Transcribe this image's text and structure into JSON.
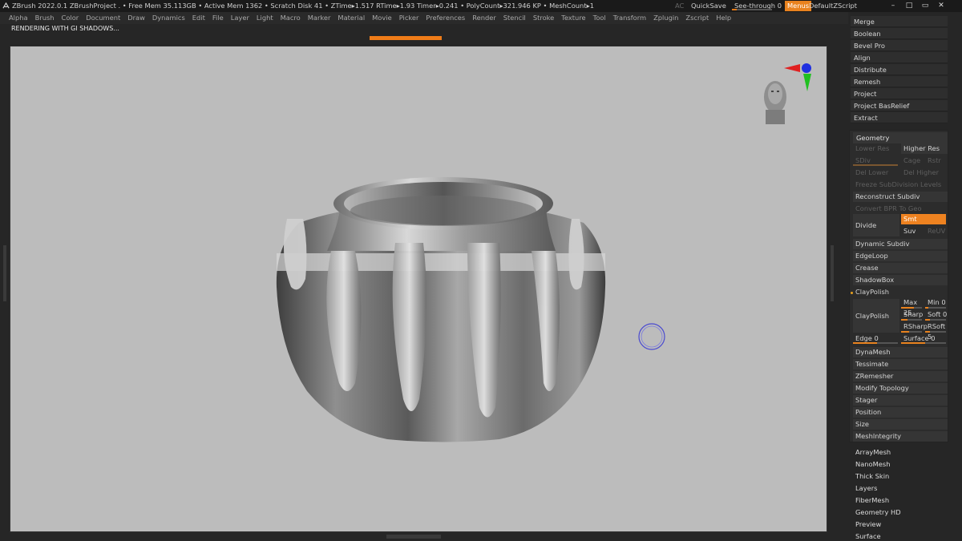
{
  "titlebar": {
    "info": "ZBrush 2022.0.1    ZBrushProject    . • Free Mem 35.113GB • Active Mem 1362 • Scratch Disk 41 • ZTime▸1.517 RTime▸1.93 Timer▸0.241 • PolyCount▸321.946 KP  • MeshCount▸1",
    "ac": "AC",
    "quicksave": "QuickSave",
    "see_through": "See-through  0",
    "see_through_value": 0,
    "menus": "Menus",
    "default_zscript": "DefaultZScript",
    "accent": "#e9821e"
  },
  "menubar": {
    "items": [
      "Alpha",
      "Brush",
      "Color",
      "Document",
      "Draw",
      "Dynamics",
      "Edit",
      "File",
      "Layer",
      "Light",
      "Macro",
      "Marker",
      "Material",
      "Movie",
      "Picker",
      "Preferences",
      "Render",
      "Stencil",
      "Stroke",
      "Texture",
      "Tool",
      "Transform",
      "Zplugin",
      "Zscript",
      "Help"
    ]
  },
  "status": "RENDERING WITH GI SHADOWS...",
  "rpanel": {
    "top_buttons": [
      "Merge",
      "Boolean",
      "Bevel Pro",
      "Align",
      "Distribute",
      "Remesh",
      "Project",
      "Project BasRelief",
      "Extract"
    ],
    "geometry": {
      "title": "Geometry",
      "lower_res": "Lower Res",
      "higher_res": "Higher Res",
      "sdiv": "SDiv",
      "cage": "Cage",
      "rstr": "Rstr",
      "del_lower": "Del Lower",
      "del_higher": "Del Higher",
      "freeze": "Freeze SubDivision Levels",
      "reconstruct": "Reconstruct Subdiv",
      "convert_bpr": "Convert BPR To Geo",
      "divide": "Divide",
      "smt": "Smt",
      "suv": "Suv",
      "reuv": "ReUV",
      "dynamic_subdiv": "Dynamic Subdiv",
      "edgeloop": "EdgeLoop",
      "crease": "Crease",
      "shadowbox": "ShadowBox",
      "claypolish_header": "ClayPolish",
      "claypolish": "ClayPolish",
      "max": "Max 25",
      "min": "Min 0",
      "sharp": "Sharp",
      "soft": "Soft 0",
      "rsharp": "RSharp",
      "rsoft": "RSoft 5",
      "edge": "Edge 0",
      "surface": "Surface 0",
      "dynamesh": "DynaMesh",
      "tessimate": "Tessimate",
      "zremesher": "ZRemesher",
      "modify_topology": "Modify Topology",
      "stager": "Stager",
      "position": "Position",
      "size": "Size",
      "meshintegrity": "MeshIntegrity"
    },
    "lower_items": [
      "ArrayMesh",
      "NanoMesh",
      "Thick Skin",
      "Layers",
      "FiberMesh",
      "Geometry HD",
      "Preview",
      "Surface"
    ]
  }
}
